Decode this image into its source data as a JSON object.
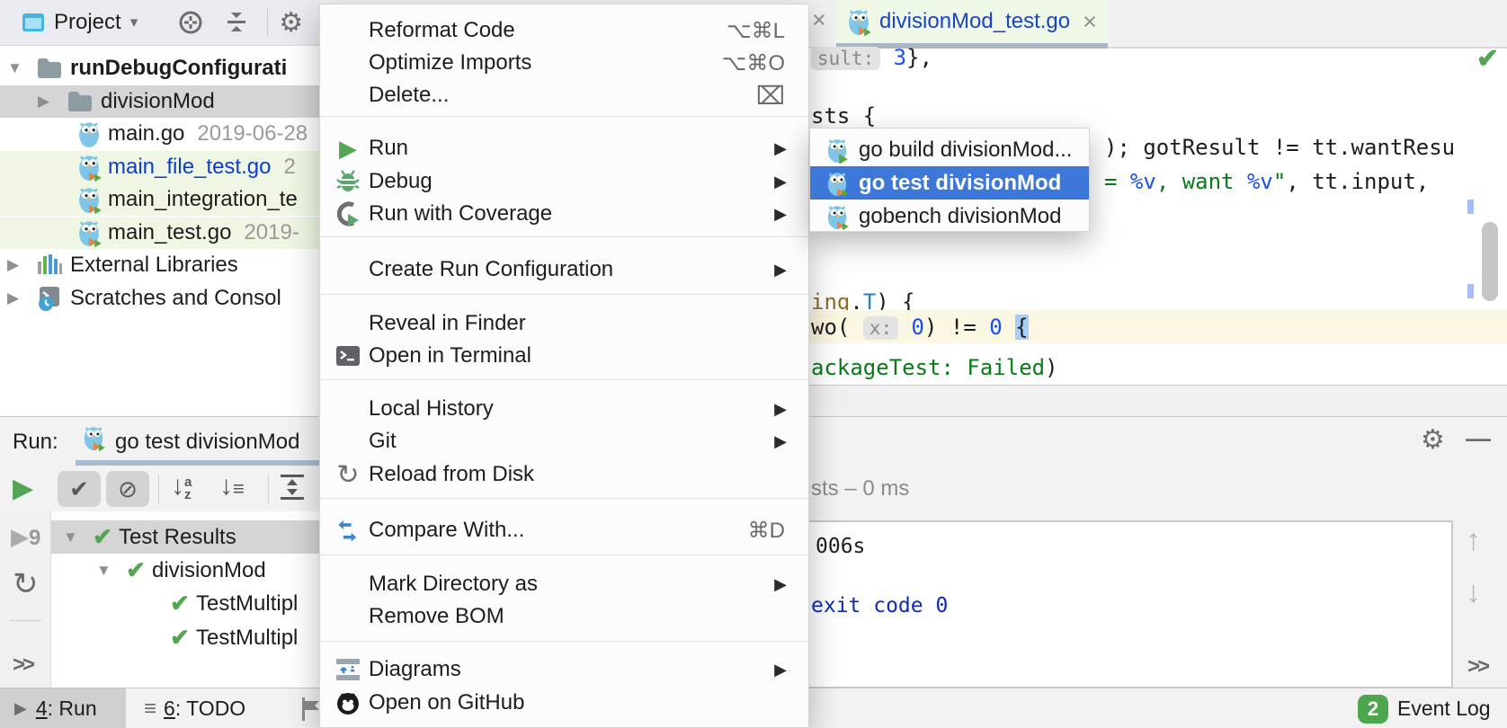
{
  "colors": {
    "selection_blue": "#3C77D9",
    "run_green": "#52A552",
    "test_pass_green": "#53A552",
    "event_badge_green": "#4CA64C",
    "modified_file_blue": "#0E3EC5",
    "tab_green_bg": "#EFF7E6",
    "current_line_yellow": "#FBF7E2"
  },
  "icons": {
    "chevron_down": "▾",
    "expand_open": "▼",
    "expand_closed": "▶",
    "check": "✔",
    "play": "▶",
    "no_entry": "⊘",
    "reload": "↻",
    "up_arrow": "↑",
    "down_arrow": "↓",
    "list": "≡",
    "gear": "⚙",
    "close": "×",
    "chevrons": ">>",
    "minimize": "—",
    "delete_key": "⌧"
  },
  "project_panel": {
    "title": "Project",
    "tree": [
      {
        "label": "runDebugConfigurati"
      },
      {
        "label": "divisionMod"
      },
      {
        "label": "main.go",
        "date": "2019-06-28"
      },
      {
        "label": "main_file_test.go",
        "date": "2"
      },
      {
        "label": "main_integration_te"
      },
      {
        "label": "main_test.go",
        "date": "2019-"
      },
      {
        "label": "External Libraries"
      },
      {
        "label": "Scratches and Consol"
      }
    ]
  },
  "context_menu": {
    "items": [
      {
        "label": "Reformat Code",
        "shortcut": "⌥⌘L"
      },
      {
        "label": "Optimize Imports",
        "shortcut": "⌥⌘O"
      },
      {
        "label": "Delete...",
        "shortcut": "⌧"
      },
      {
        "label": "Run"
      },
      {
        "label": "Debug"
      },
      {
        "label": "Run with Coverage"
      },
      {
        "label": "Create Run Configuration"
      },
      {
        "label": "Reveal in Finder"
      },
      {
        "label": "Open in Terminal"
      },
      {
        "label": "Local History"
      },
      {
        "label": "Git"
      },
      {
        "label": "Reload from Disk"
      },
      {
        "label": "Compare With...",
        "shortcut": "⌘D"
      },
      {
        "label": "Mark Directory as"
      },
      {
        "label": "Remove BOM"
      },
      {
        "label": "Diagrams"
      },
      {
        "label": "Open on GitHub"
      }
    ]
  },
  "run_submenu": {
    "items": [
      {
        "label": "go build divisionMod..."
      },
      {
        "label": "go test divisionMod",
        "selected": true
      },
      {
        "label": "gobench divisionMod"
      }
    ]
  },
  "editor": {
    "tab": "divisionMod_test.go",
    "code": {
      "l1": {
        "hint": "sult:",
        "num": "3",
        "tail": "},"
      },
      "l2": {
        "text": "sts {"
      },
      "l3": {
        "text": "); gotResult != tt.wantResu"
      },
      "l4": {
        "s1": "= ",
        "v1": "%v",
        "s2": ", want ",
        "v2": "%v",
        "s3": "\"",
        "tail": ", tt.input,"
      },
      "l5": {
        "p1": "ing",
        "p2": ".",
        "p3": "T",
        "p4": ") {"
      },
      "l6": {
        "p1": "wo( ",
        "hint": "x:",
        "n1": "0",
        "p2": ") != ",
        "n2": "0",
        "brace": "{"
      },
      "l7": {
        "s": "ackageTest: Failed",
        "tail": ")"
      }
    }
  },
  "run_panel": {
    "label": "Run:",
    "tab": "go test divisionMod",
    "status": "sts – 0 ms",
    "tree": [
      {
        "label": "Test Results"
      },
      {
        "label": "divisionMod"
      },
      {
        "label": "TestMultipl"
      },
      {
        "label": "TestMultipl"
      }
    ],
    "console": {
      "line1": "006s",
      "line2": "exit code 0"
    },
    "rerun_failed_count": "9"
  },
  "status_bar": {
    "run": "4: Run",
    "run_key": "4",
    "run_rest": ": Run",
    "todo_key": "6",
    "todo_rest": ": TODO",
    "event_log": "Event Log",
    "event_badge": "2"
  }
}
